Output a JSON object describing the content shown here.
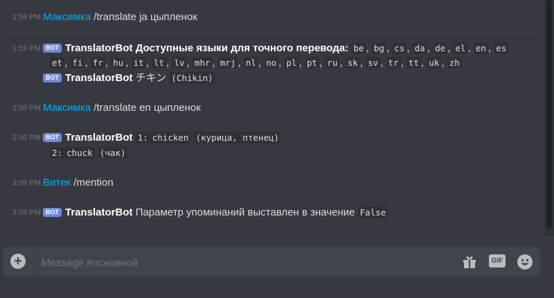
{
  "channel": {
    "placeholder": "Message #основной"
  },
  "messages": [
    {
      "time": "1:59 PM",
      "author": "Максимка",
      "text": "/translate ja цыпленок"
    },
    {
      "time": "1:59 PM",
      "badge": "BOT",
      "author": "TranslatorBot",
      "title": "Доступные языки для точного перевода:",
      "langs_row1": [
        "be",
        "bg",
        "cs",
        "da",
        "de",
        "el",
        "en",
        "es"
      ],
      "langs_row2": [
        "et",
        "fi",
        "fr",
        "hu",
        "it",
        "lt",
        "lv",
        "mhr",
        "mrj",
        "nl",
        "no",
        "pl",
        "pt",
        "ru",
        "sk",
        "sv",
        "tr",
        "tt",
        "uk",
        "zh"
      ],
      "followup_badge": "BOT",
      "followup_author": "TranslatorBot",
      "followup_text_jp": "チキン",
      "followup_text_code": "(Chikin)"
    },
    {
      "time": "2:00 PM",
      "author": "Максимка",
      "text": "/translate en цыпленок"
    },
    {
      "time": "2:00 PM",
      "badge": "BOT",
      "author": "TranslatorBot",
      "line1_num": "1:",
      "line1_word": "chicken",
      "line1_extra": "(курица, птенец)",
      "line2_num": "2:",
      "line2_word": "chuck",
      "line2_extra": "(чак)"
    },
    {
      "time": "3:09 PM",
      "author": "Витек",
      "text": "/mention"
    },
    {
      "time": "3:09 PM",
      "badge": "BOT",
      "author": "TranslatorBot",
      "text": "Параметр упоминаний выставлен в значение",
      "code": "False"
    }
  ],
  "toolbar": {
    "plus_label": "+",
    "gif_label": "GIF"
  },
  "icons": [
    "add-icon",
    "gift-icon",
    "gif-icon",
    "emoji-icon"
  ],
  "colors": {
    "background": "#36393f",
    "username": "#00b0f4",
    "bot_badge": "#7289da",
    "composer": "#40444b"
  }
}
